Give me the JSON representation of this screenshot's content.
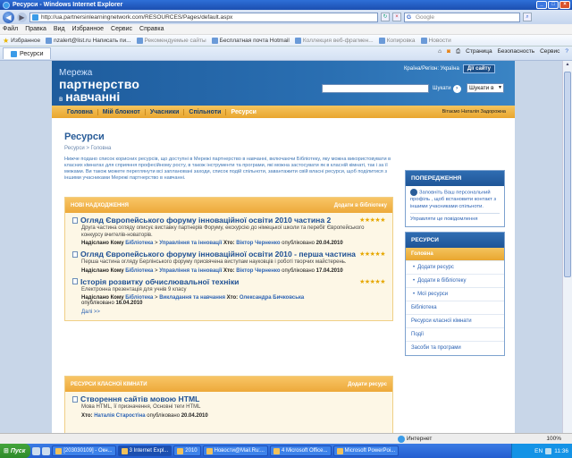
{
  "window": {
    "title": "Ресурси - Windows Internet Explorer"
  },
  "address": {
    "url": "http://ua.partnersinlearningnetwork.com/RESOURCES/Pages/default.aspx",
    "search_placeholder": "Google"
  },
  "menu": [
    "Файл",
    "Правка",
    "Вид",
    "Избранное",
    "Сервис",
    "Справка"
  ],
  "favorites": {
    "label": "Избранное",
    "items": [
      {
        "label": "nzalert@list.ru Написать пи...",
        "dim": false
      },
      {
        "label": "Рекомендуемые сайты",
        "dim": true
      },
      {
        "label": "Бесплатная почта Hotmail",
        "dim": false
      },
      {
        "label": "Коллекция веб-фрагмен...",
        "dim": true
      },
      {
        "label": "Копировка",
        "dim": true
      },
      {
        "label": "Новости",
        "dim": true
      }
    ]
  },
  "tab": {
    "label": "Ресурси"
  },
  "commandbar": [
    "Страница",
    "Безопасность",
    "Сервис"
  ],
  "site": {
    "logo_line1": "Мережа",
    "logo_line2": "партнерство",
    "logo_small": "в",
    "logo_line3": "навчанні",
    "region": "Країна/Регіон: Україна",
    "login": "Дії сайту",
    "search_button": "Шукати",
    "search_scope": "Шукати в",
    "nav": [
      {
        "label": "Головна",
        "active": false
      },
      {
        "label": "Мій блокнот",
        "active": false
      },
      {
        "label": "Учасники",
        "active": false
      },
      {
        "label": "Спільноти",
        "active": false
      },
      {
        "label": "Ресурси",
        "active": true
      }
    ],
    "welcome": "Вітаємо Наталія Задорожна"
  },
  "page": {
    "title": "Ресурси",
    "breadcrumb": "Ресурси > Головна",
    "intro": "Нижче подано список корисних ресурсів, що доступні в Мережі партнерство в навчанні, включаючи Бібліотеку, яку можна використовувати в класних кімнатах для сприяння професійному росту, в також інструменти та програми, які можна застосувати як в класній кімнаті, так і за її межами. Ви також можете переглянути всі заплановані заходи, список подій спільноти, завантажити свій власні ресурси, щоб поділитися з іншими учасниками Мережі партнерство в навчанні."
  },
  "new_panel": {
    "title": "НОВІ НАДХОДЖЕННЯ",
    "action": "Додати в бібліотеку",
    "items": [
      {
        "title": "Огляд Європейського форуму інноваційної освіти 2010 частина 2",
        "stars": "★★★★★",
        "desc": "Друга частина огляду описує виставку партнерів Форуму, екскурсію до німецької школи та перебіг Європейського конкурсу вчителів-новаторів.",
        "sent_to_label": "Надіслано Кому",
        "sent_to": "Бібліотека",
        "category": "Управління та інновації",
        "who_label": "Хто:",
        "who": "Віктор Черненко",
        "published_label": "опубліковано",
        "date": "20.04.2010"
      },
      {
        "title": "Огляд Європейського форуму інноваційної освіти 2010 - перша частина",
        "stars": "★★★★★",
        "desc": "Перша частина огляду Берлінського форуму присвячена виступам науковців і роботі творчих майстерень.",
        "sent_to_label": "Надіслано Кому",
        "sent_to": "Бібліотека",
        "category": "Управління та інновації",
        "who_label": "Хто:",
        "who": "Віктор Черненко",
        "published_label": "опубліковано",
        "date": "17.04.2010"
      },
      {
        "title": "Історія розвитку обчислювальної техніки",
        "stars": "★★★★★",
        "desc": "Електронна презентація для учнів 9 класу",
        "sent_to_label": "Надіслано Кому",
        "sent_to": "Бібліотека",
        "category": "Викладання та навчання",
        "who_label": "Хто:",
        "who": "Олександра Бичковська",
        "published_label": "опубліковано",
        "date": "16.04.2010"
      }
    ],
    "more": "Далі >>"
  },
  "class_panel": {
    "title": "РЕСУРСИ КЛАСНОЇ КІМНАТИ",
    "action": "Додати ресурс",
    "items": [
      {
        "title": "Створення сайтів мовою HTML",
        "desc": "Мова HTML, її призначення, Основні теги HTML",
        "who_label": "Хто:",
        "who": "Наталія Старостіна",
        "published_label": "опубліковано",
        "date": "20.04.2010"
      }
    ]
  },
  "sidebar": {
    "warning_title": "ПОПЕРЕДЖЕННЯ",
    "warning_text": "Заповніть Ваш персональний профіль , щоб встановити контакт з іншими учасниками спільноти.",
    "warning_link": "Управляти це повідомлення",
    "resources_title": "РЕСУРСИ",
    "menu": [
      {
        "label": "Головна",
        "active": true,
        "sub": false
      },
      {
        "label": "Додати ресурс",
        "active": false,
        "sub": true
      },
      {
        "label": "Додати в бібліотеку",
        "active": false,
        "sub": true
      },
      {
        "label": "Мої ресурси",
        "active": false,
        "sub": true
      },
      {
        "label": "Бібліотека",
        "active": false,
        "sub": false
      },
      {
        "label": "Ресурси класної кімнати",
        "active": false,
        "sub": false
      },
      {
        "label": "Події",
        "active": false,
        "sub": false
      },
      {
        "label": "Засоби та програми",
        "active": false,
        "sub": false
      }
    ]
  },
  "status": {
    "zone": "Интернет",
    "zoom": "100%"
  },
  "taskbar": {
    "start": "Пуск",
    "tasks": [
      {
        "label": "[203030109] - Окн...",
        "active": false
      },
      {
        "label": "3 Internet Expl...",
        "active": true
      },
      {
        "label": "2010",
        "active": false
      },
      {
        "label": "Новости@Mail.Ru:...",
        "active": false
      },
      {
        "label": "4 Microsoft Office...",
        "active": false
      },
      {
        "label": "Microsoft PowerPoi...",
        "active": false
      }
    ],
    "lang": "EN",
    "clock": "11:36"
  }
}
